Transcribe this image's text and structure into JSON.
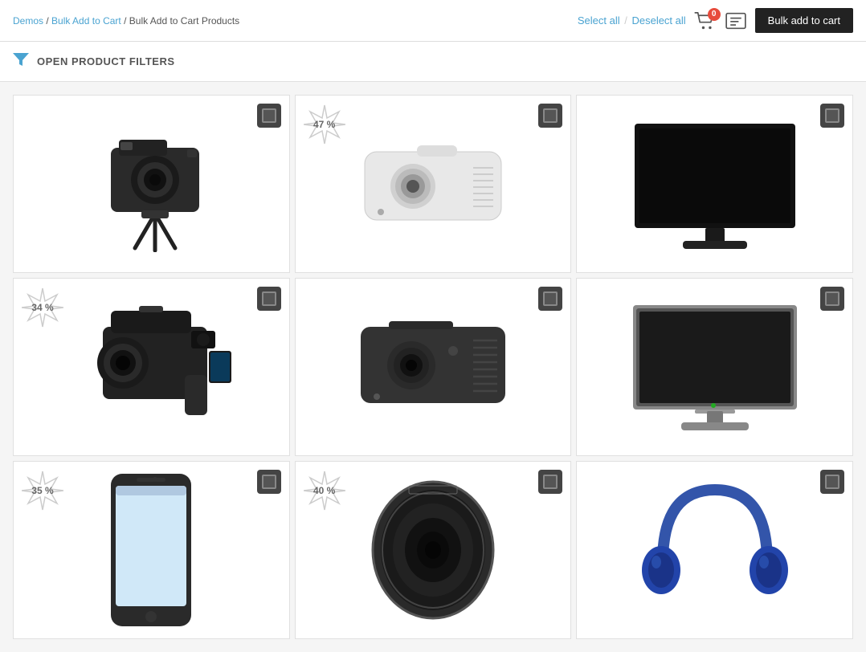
{
  "breadcrumb": {
    "items": [
      {
        "label": "Demos",
        "href": "#"
      },
      {
        "label": "Bulk Add to Cart",
        "href": "#"
      },
      {
        "label": "Bulk Add to Cart Products",
        "href": null
      }
    ],
    "separator": "/"
  },
  "actions": {
    "select_all": "Select all",
    "deselect_all": "Deselect all",
    "separator": "/",
    "cart_badge": "0",
    "bulk_button": "Bulk add to cart"
  },
  "filter": {
    "label": "OPEN PRODUCT FILTERS",
    "icon": "filter-icon"
  },
  "products": [
    {
      "id": 1,
      "discount": null,
      "type": "camera"
    },
    {
      "id": 2,
      "discount": "47%",
      "type": "projector-white"
    },
    {
      "id": 3,
      "discount": null,
      "type": "monitor-black"
    },
    {
      "id": 4,
      "discount": "34%",
      "type": "camcorder"
    },
    {
      "id": 5,
      "discount": null,
      "type": "projector-dark"
    },
    {
      "id": 6,
      "discount": null,
      "type": "monitor-silver"
    },
    {
      "id": 7,
      "discount": "35%",
      "type": "phone"
    },
    {
      "id": 8,
      "discount": "40%",
      "type": "lens"
    },
    {
      "id": 9,
      "discount": null,
      "type": "headphones"
    }
  ],
  "colors": {
    "link": "#4aa3d1",
    "dark_btn": "#222",
    "badge_bg": "#e74c3c"
  }
}
